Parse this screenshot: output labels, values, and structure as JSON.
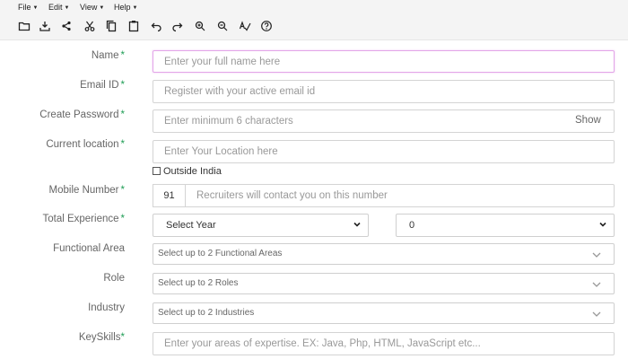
{
  "menubar": {
    "items": [
      {
        "label": "File"
      },
      {
        "label": "Edit"
      },
      {
        "label": "View"
      },
      {
        "label": "Help"
      }
    ]
  },
  "toolbar": {
    "icons": [
      "folder-icon",
      "download-icon",
      "share-icon",
      "cut-icon",
      "copy-icon",
      "paste-icon",
      "undo-icon",
      "redo-icon",
      "zoom-in-icon",
      "zoom-out-icon",
      "spellcheck-icon",
      "help-icon"
    ]
  },
  "form": {
    "name": {
      "label": "Name",
      "required_mark": "*",
      "placeholder": "Enter your full name here"
    },
    "email": {
      "label": "Email ID",
      "required_mark": "*",
      "placeholder": "Register with your active email id"
    },
    "password": {
      "label": "Create Password",
      "required_mark": "*",
      "placeholder": "Enter minimum 6 characters",
      "show_label": "Show"
    },
    "location": {
      "label": "Current location",
      "required_mark": "*",
      "placeholder": "Enter Your Location here"
    },
    "outside_india": {
      "label": "Outside India",
      "checked": false
    },
    "mobile": {
      "label": "Mobile Number",
      "required_mark": "*",
      "country_code": "91",
      "placeholder": "Recruiters will contact you on this number"
    },
    "experience": {
      "label": "Total Experience",
      "required_mark": "*",
      "year_value": "Select Year",
      "month_value": "0"
    },
    "functional_area": {
      "label": "Functional Area",
      "placeholder": "Select up to 2 Functional Areas"
    },
    "role": {
      "label": "Role",
      "placeholder": "Select up to 2 Roles"
    },
    "industry": {
      "label": "Industry",
      "placeholder": "Select up to 2 Industries"
    },
    "keyskills": {
      "label": "KeySkills",
      "required_mark": "*",
      "placeholder": "Enter your areas of expertise. EX: Java, Php, HTML, JavaScript etc..."
    }
  },
  "colors": {
    "required": "#1f9d55",
    "focus_border": "#e3a5e8"
  }
}
